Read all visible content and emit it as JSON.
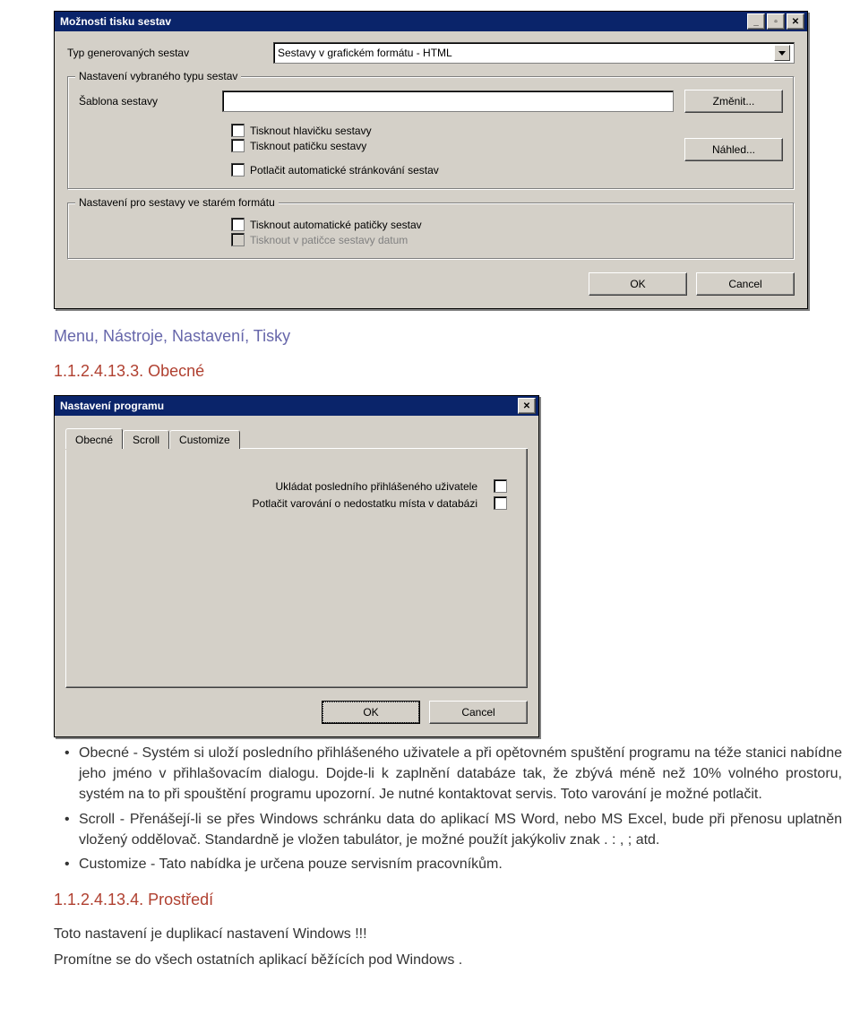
{
  "dialog1": {
    "title": "Možnosti tisku sestav",
    "type_label": "Typ generovaných sestav",
    "type_value": "Sestavy v grafickém formátu - HTML",
    "group1": {
      "legend": "Nastavení vybraného typu sestav",
      "template_label": "Šablona sestavy",
      "change_btn": "Změnit...",
      "cb_header": "Tisknout hlavičku sestavy",
      "cb_footer": "Tisknout patičku sestavy",
      "cb_suppress": "Potlačit automatické stránkování sestav",
      "preview_btn": "Náhled..."
    },
    "group2": {
      "legend": "Nastavení pro sestavy ve starém formátu",
      "cb_autofoot": "Tisknout automatické patičky sestav",
      "cb_date": "Tisknout v patičce sestavy datum"
    },
    "ok": "OK",
    "cancel": "Cancel"
  },
  "doc": {
    "path": "Menu, Nástroje, Nastavení, Tisky",
    "sec1_no": "1.1.2.4.13.3. Obecné",
    "sec2_no": "1.1.2.4.13.4. Prostředí",
    "bul1": "Obecné - Systém si uloží posledního přihlášeného uživatele a při opětovném spuštění programu na téže stanici nabídne jeho jméno v přihlašovacím dialogu. Dojde-li k zaplnění databáze tak, že zbývá méně než 10% volného prostoru, systém na to při spouštění programu upozorní. Je nutné kontaktovat servis. Toto varování je možné potlačit.",
    "bul2": "Scroll - Přenášejí-li se přes Windows schránku data do aplikací MS Word, nebo MS Excel, bude při přenosu uplatněn vložený oddělovač. Standardně je vložen tabulátor, je možné použít jakýkoliv znak  . : , ;  atd.",
    "bul3": "Customize - Tato nabídka je určena pouze servisním pracovníkům.",
    "p1": "Toto nastavení je duplikací nastavení Windows !!!",
    "p2": "Promítne se do všech ostatních aplikací běžících pod Windows ."
  },
  "dialog2": {
    "title": "Nastavení programu",
    "tabs": [
      "Obecné",
      "Scroll",
      "Customize"
    ],
    "row1": "Ukládat posledního přihlášeného uživatele",
    "row2": "Potlačit varování o nedostatku místa v databázi",
    "ok": "OK",
    "cancel": "Cancel"
  }
}
